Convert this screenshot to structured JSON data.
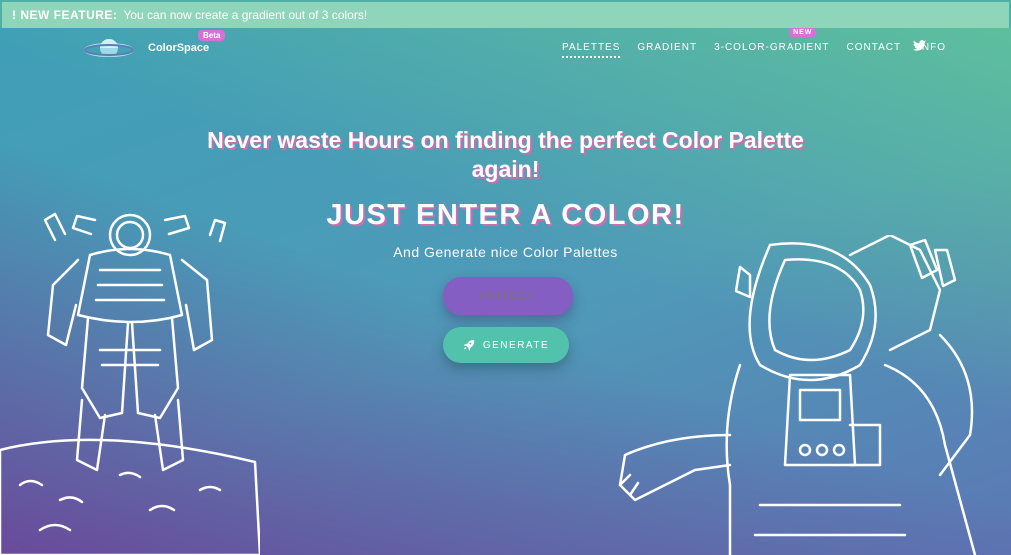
{
  "banner": {
    "label": "! NEW FEATURE:",
    "message": "You can now create a gradient out of 3 colors!"
  },
  "brand": {
    "name": "ColorSpace",
    "badge": "Beta"
  },
  "nav": {
    "items": [
      {
        "label": "PALETTES",
        "active": true
      },
      {
        "label": "GRADIENT"
      },
      {
        "label": "3-COLOR-GRADIENT",
        "badge": "NEW"
      },
      {
        "label": "CONTACT"
      },
      {
        "label": "INFO"
      }
    ],
    "social_icon": "twitter-icon"
  },
  "hero": {
    "headline_line1": "Never waste Hours on finding the perfect Color Palette",
    "headline_line2": "again!",
    "sub_headline": "JUST ENTER A COLOR!",
    "tagline": "And Generate nice Color Palettes"
  },
  "form": {
    "color_placeholder": "#845EC2",
    "generate_label": "GENERATE",
    "generate_icon": "rocket-icon"
  },
  "colors": {
    "input_bg": "#845EC2",
    "button_bg": "#53C2AD",
    "badge": "#D970D8"
  }
}
